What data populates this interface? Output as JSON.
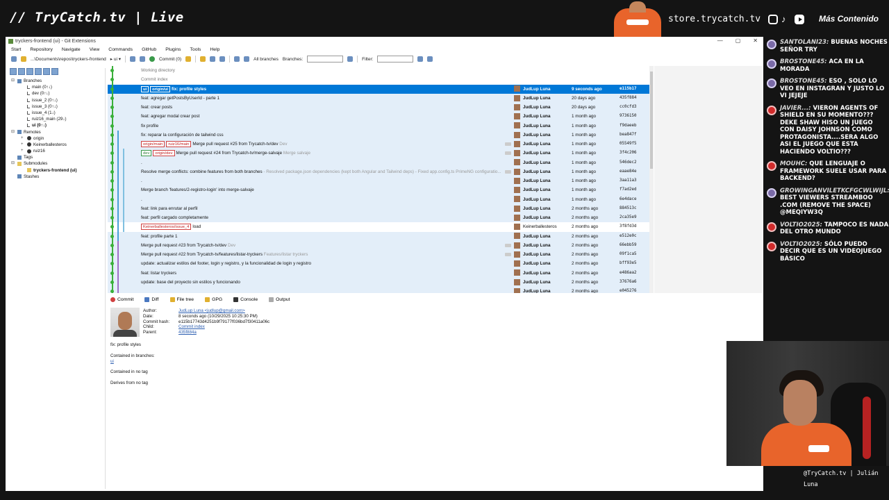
{
  "overlay": {
    "brand": "// TryCatch.tv | Live",
    "store": "store.trycatch.tv",
    "more": "Más Contenido",
    "handle": "@TryCatch.tv | Julián Luna",
    "chat": [
      {
        "user": "SANTOLANI23:",
        "text": " BUENAS NOCHES SEÑOR TRY",
        "platform": "twitch"
      },
      {
        "user": "BROSTONE45:",
        "text": " ACA EN LA MORADA",
        "platform": "twitch"
      },
      {
        "user": "BROSTONE45:",
        "text": " ESO , SOLO LO VEO EN INSTAGRAN Y JUSTO LO VI JEJEJE",
        "platform": "twitch"
      },
      {
        "user": "JAVIER...:",
        "text": " VIERON AGENTS OF SHIELD EN SU MOMENTO??? DEKE SHAW HISO UN JUEGO CON DAISY JOHNSON COMO PROTAGONISTA....SERA ALGO ASI EL JUEGO QUE ESTA HACIENDO VOLTIO???",
        "platform": "youtube"
      },
      {
        "user": "MOUHC:",
        "text": " QUE LENGUAJE O FRAMEWORK SUELE USAR PARA BACKEND?",
        "platform": "youtube"
      },
      {
        "user": "GROWINGANVILETKCFGCWLWIJL:",
        "text": " BEST VIEWERS STREAMBOO .COM (REMOVE THE SPACE) @MEQIYW3Q",
        "platform": "twitch"
      },
      {
        "user": "VOLTIO2025:",
        "text": " TAMPOCO ES NADA DEL OTRO MUNDO",
        "platform": "youtube"
      },
      {
        "user": "VOLTIO2025:",
        "text": " SÓLO PUEDO DECIR QUE ES UN VIDEOJUEGO BÁSICO",
        "platform": "youtube"
      }
    ]
  },
  "window": {
    "title": "tryckers-frontend (ui) - Git Extensions",
    "menu": [
      "Start",
      "Repository",
      "Navigate",
      "View",
      "Commands",
      "GitHub",
      "Plugins",
      "Tools",
      "Help"
    ],
    "toolbar": {
      "path": "...\\Documents\\repos\\tryckers-frontend",
      "branch": "ui",
      "commit": "Commit (0)",
      "all_branches": "All branches",
      "branches_label": "Branches:",
      "filter_label": "Filter:"
    }
  },
  "tree": [
    {
      "label": "Branches",
      "level": 0,
      "exp": "⊟",
      "icon": "branches-icon"
    },
    {
      "label": "main (0↑↓)",
      "level": 1,
      "icon": "branch-icon"
    },
    {
      "label": "dev (0↑↓)",
      "level": 1,
      "icon": "branch-icon"
    },
    {
      "label": "issue_2 (0↑↓)",
      "level": 1,
      "icon": "branch-icon"
    },
    {
      "label": "issue_3 (0↑↓)",
      "level": 1,
      "icon": "branch-icon"
    },
    {
      "label": "issue_4 (1↓)",
      "level": 1,
      "icon": "branch-icon"
    },
    {
      "label": "ruiz16_main (29↓)",
      "level": 1,
      "icon": "branch-icon"
    },
    {
      "label": "ui (0↑↓)",
      "level": 1,
      "icon": "branch-icon",
      "bold": true
    },
    {
      "label": "Remotes",
      "level": 0,
      "exp": "⊟",
      "icon": "remotes-icon"
    },
    {
      "label": "origin",
      "level": 1,
      "exp": "+",
      "icon": "github-icon"
    },
    {
      "label": "Keinerballesteros",
      "level": 1,
      "exp": "+",
      "icon": "github-icon"
    },
    {
      "label": "ruiz16",
      "level": 1,
      "exp": "+",
      "icon": "github-icon"
    },
    {
      "label": "Tags",
      "level": 0,
      "icon": "tags-icon"
    },
    {
      "label": "Submodules",
      "level": 0,
      "exp": "⊟",
      "icon": "submodules-icon"
    },
    {
      "label": "tryckers-frontend (ui)",
      "level": 1,
      "icon": "folder-icon",
      "bold": true
    },
    {
      "label": "Stashes",
      "level": 0,
      "icon": "stashes-icon"
    }
  ],
  "grid": {
    "rows": [
      {
        "kind": "special",
        "message": "Working directory"
      },
      {
        "kind": "special",
        "message": "Commit index"
      },
      {
        "kind": "sel",
        "tags": [
          "ui",
          "origin/ui"
        ],
        "message": "fix: profile styles",
        "author": "JudLup Luna",
        "date": "9 seconds ago",
        "hash": "e115b17"
      },
      {
        "kind": "t",
        "message": "feat: agregar getPostsByUserId - parte 1",
        "author": "JudLup Luna",
        "date": "20 days ago",
        "hash": "435f884"
      },
      {
        "kind": "t",
        "message": "feat: crear posts",
        "author": "JudLup Luna",
        "date": "20 days ago",
        "hash": "cc0cfd3"
      },
      {
        "kind": "t",
        "message": "feat: agregar modal crear post",
        "author": "JudLup Luna",
        "date": "1 month ago",
        "hash": "9736150"
      },
      {
        "kind": "t",
        "message": "fix profile",
        "author": "JudLup Luna",
        "date": "1 month ago",
        "hash": "f9daeeb"
      },
      {
        "kind": "t",
        "message": "fix: reparar la configuración de tailwind css",
        "author": "JudLup Luna",
        "date": "1 month ago",
        "hash": "bea847f"
      },
      {
        "kind": "t",
        "tags": [
          "origin/main",
          "ruiz16/main"
        ],
        "message": "Merge pull request #25 from Trycatch-tv/dev",
        "extra": "Dev",
        "author": "JudLup Luna",
        "date": "1 month ago",
        "hash": "05549f5",
        "dots": true
      },
      {
        "kind": "t",
        "tags": [
          "dev",
          "origin/dev"
        ],
        "message": "Merge pull request #24 from Trycatch-tv/merge-salvaje",
        "extra": "Merge salvaje",
        "author": "JudLup Luna",
        "date": "1 month ago",
        "hash": "3f4c206",
        "dots": true
      },
      {
        "kind": "t",
        "message": ".",
        "author": "JudLup Luna",
        "date": "1 month ago",
        "hash": "546dec2"
      },
      {
        "kind": "t",
        "message": "Resolve merge conflicts: combine features from both branches",
        "extra": "- Resolved package.json dependencies (kept both Angular and Tailwind deps) - Fixed app.config.ts PrimeNG configuratio...",
        "author": "JudLup Luna",
        "date": "1 month ago",
        "hash": "eaae84e",
        "dots": true
      },
      {
        "kind": "t",
        "message": ".",
        "author": "JudLup Luna",
        "date": "1 month ago",
        "hash": "3aa11a3"
      },
      {
        "kind": "t",
        "message": "Merge branch 'features/2-registro-login' into merge-salvaje",
        "author": "JudLup Luna",
        "date": "1 month ago",
        "hash": "f7ad2ed"
      },
      {
        "kind": "t",
        "message": ".",
        "author": "JudLup Luna",
        "date": "1 month ago",
        "hash": "6e4dace"
      },
      {
        "kind": "t",
        "message": "feat: link para enrutar al perfil",
        "author": "JudLup Luna",
        "date": "2 months ago",
        "hash": "884513c"
      },
      {
        "kind": "t",
        "message": "feat: perfil cargado completamente",
        "author": "JudLup Luna",
        "date": "2 months ago",
        "hash": "2ca35e9"
      },
      {
        "kind": "w",
        "tags": [
          "Keinerballesteros/issue_4"
        ],
        "message": "load",
        "author": "Keinerballesteros",
        "date": "2 months ago",
        "hash": "3f8fd3d",
        "normal": true
      },
      {
        "kind": "t",
        "message": "feat: profile parte 1",
        "author": "JudLup Luna",
        "date": "2 months ago",
        "hash": "e512e0c"
      },
      {
        "kind": "t",
        "message": "Merge pull request #23 from Trycatch-tv/dev",
        "extra": "Dev",
        "author": "JudLup Luna",
        "date": "2 months ago",
        "hash": "66ebb59",
        "dots": true
      },
      {
        "kind": "t",
        "message": "Merge pull request #22 from Trycatch-tv/features/listar-tryckers",
        "extra": "Features/listar tryckers",
        "author": "JudLup Luna",
        "date": "2 months ago",
        "hash": "09f1ca5",
        "dots": true
      },
      {
        "kind": "t",
        "message": "update: actualizar estilos del footer, login y registro, y la funcionalidad de login y registro",
        "author": "JudLup Luna",
        "date": "2 months ago",
        "hash": "bff93e5"
      },
      {
        "kind": "t",
        "message": "feat: listar tryckers",
        "author": "JudLup Luna",
        "date": "2 months ago",
        "hash": "e486aa2"
      },
      {
        "kind": "t",
        "message": "update: base del proyecto sin estilos y funcionando",
        "author": "JudLup Luna",
        "date": "2 months ago",
        "hash": "37676a6"
      },
      {
        "kind": "t",
        "message": "",
        "author": "JudLup Luna",
        "date": "2 months ago",
        "hash": "e045276"
      }
    ]
  },
  "tabs": [
    "Commit",
    "Diff",
    "File tree",
    "GPG",
    "Console",
    "Output"
  ],
  "detail": {
    "author_label": "Author:",
    "author": "JudLup Luna <judlup@gmail.com>",
    "date_label": "Date:",
    "date": "8 seconds ago (10/29/2025 10:25:30 PM)",
    "hash_label": "Commit hash:",
    "hash": "e115b17743d4251b9f79177f036bd7f30411a06c",
    "child_label": "Child:",
    "child": "Commit index",
    "parent_label": "Parent:",
    "parent": "435f884a",
    "subject": "fix: profile styles",
    "contained_branches": "Contained in branches:",
    "branch_link": "ui",
    "contained_tag": "Contained in no tag",
    "derives": "Derives from no tag"
  }
}
